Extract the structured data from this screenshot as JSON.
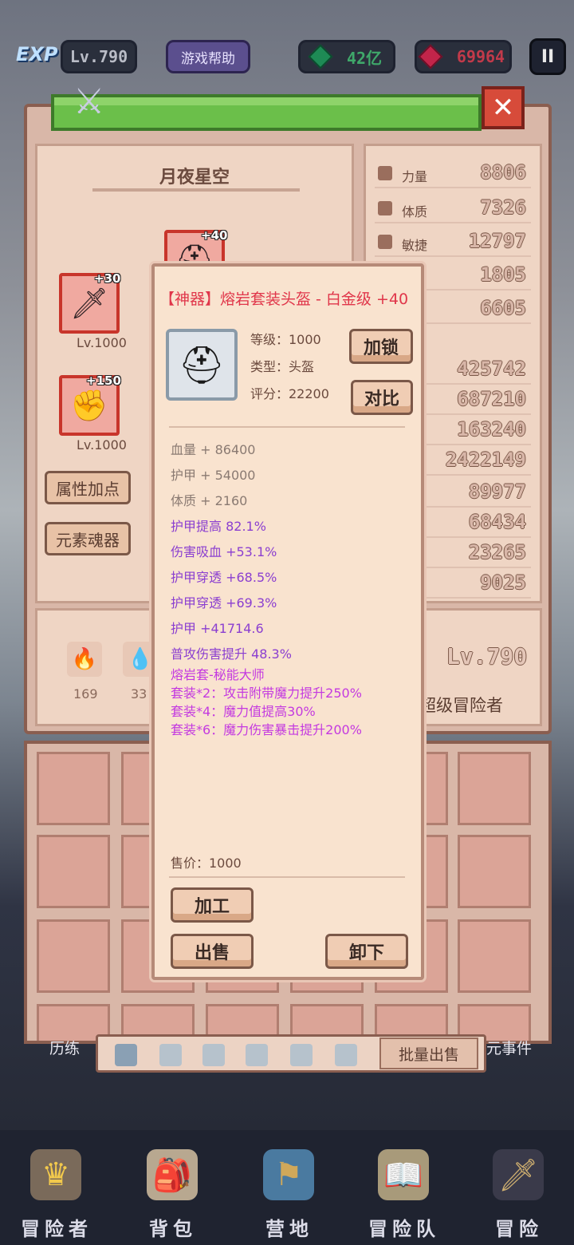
{
  "hud": {
    "exp_label": "EXP",
    "level": "Lv.790",
    "help": "游戏帮助",
    "emerald": "42亿",
    "ruby": "69964",
    "pause": "II"
  },
  "set_name": "月夜星空",
  "equip_slots": [
    {
      "plus": "+40",
      "level": ""
    },
    {
      "plus": "+30",
      "level": "Lv.1000"
    },
    {
      "plus": "+150",
      "level": "Lv.1000"
    }
  ],
  "left_buttons": {
    "attr_points": "属性加点",
    "element_soul": "元素魂器"
  },
  "stats": [
    {
      "name": "力量",
      "value": "8806"
    },
    {
      "name": "体质",
      "value": "7326"
    },
    {
      "name": "敏捷",
      "value": "12797"
    },
    {
      "name": "",
      "value": "1805"
    },
    {
      "name": "",
      "value": "6605"
    },
    {
      "name": "",
      "value": "425742"
    },
    {
      "name": "",
      "value": "687210"
    },
    {
      "name": "",
      "value": "163240"
    },
    {
      "name": "",
      "value": "2422149"
    },
    {
      "name": "",
      "value": "89977"
    },
    {
      "name": "",
      "value": "68434"
    },
    {
      "name": "",
      "value": "23265"
    },
    {
      "name": "",
      "value": "9025"
    }
  ],
  "elements": [
    {
      "count": "169"
    },
    {
      "count": "33"
    }
  ],
  "hero": {
    "level": "Lv.790",
    "rank": "超级冒险者"
  },
  "bottom_tabs": {
    "bulk_sell": "批量出售",
    "left_side": "历练",
    "right_side": "元事件"
  },
  "nav": [
    {
      "label": "冒险者"
    },
    {
      "label": "背包"
    },
    {
      "label": "营地"
    },
    {
      "label": "冒险队"
    },
    {
      "label": "冒险"
    }
  ],
  "item": {
    "title": "【神器】熔岩套装头盔 - 白金级 +40",
    "level": "等级：1000",
    "type": "类型：头盔",
    "score": "评分：22200",
    "lock_btn": "加锁",
    "compare_btn": "对比",
    "base_attrs": [
      "血量 + 86400",
      "护甲 + 54000",
      "体质 + 2160"
    ],
    "bonus_attrs": [
      "护甲提高 82.1%",
      "伤害吸血 +53.1%",
      "护甲穿透 +68.5%",
      "护甲穿透 +69.3%",
      "护甲 +41714.6",
      "普攻伤害提升 48.3%"
    ],
    "set_lines": [
      "熔岩套-秘能大师",
      "套装*2：攻击附带魔力提升250%",
      "套装*4：魔力值提高30%",
      "套装*6：魔力伤害暴击提升200%"
    ],
    "price": "售价：1000",
    "process_btn": "加工",
    "sell_btn": "出售",
    "unequip_btn": "卸下"
  }
}
